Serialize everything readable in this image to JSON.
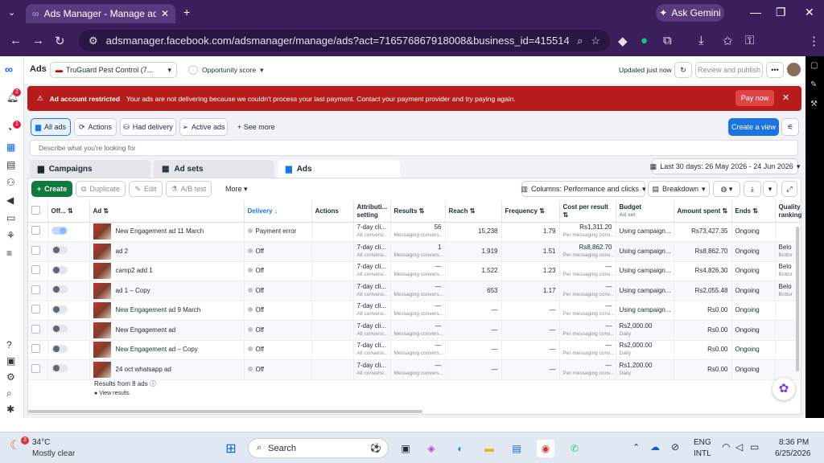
{
  "browser": {
    "tab_title": "Ads Manager - Manage ads - A",
    "url": "adsmanager.facebook.com/adsmanager/manage/ads?act=716576867918008&business_id=4155148604624818...",
    "gemini": "Ask Gemini"
  },
  "topbar": {
    "ads_label": "Ads",
    "account": "TruGuard Pest Control (7...",
    "opportunity": "Opportunity score",
    "updated": "Updated just now",
    "review": "Review and publish",
    "alert_badge": "2",
    "alert_badge2": "1"
  },
  "alert": {
    "title": "Ad account restricted",
    "message": "Your ads are not delivering because we couldn't process your last payment. Contact your payment provider and try paying again.",
    "pay": "Pay now"
  },
  "filters": {
    "all_ads": "All ads",
    "actions": "Actions",
    "had_delivery": "Had delivery",
    "active_ads": "Active ads",
    "see_more": "See more",
    "create_view": "Create a view"
  },
  "search": {
    "placeholder": "Describe what you're looking for"
  },
  "levels": {
    "campaigns": "Campaigns",
    "ad_sets": "Ad sets",
    "ads": "Ads"
  },
  "date_range": "Last 30 days: 26 May 2026 - 24 Jun 2026",
  "toolbar": {
    "create": "Create",
    "duplicate": "Duplicate",
    "edit": "Edit",
    "ab_test": "A/B test",
    "more": "More",
    "columns": "Columns: Performance and clicks",
    "breakdown": "Breakdown"
  },
  "columns": {
    "off_on": "Off...",
    "ad": "Ad",
    "delivery": "Delivery",
    "actions": "Actions",
    "attribution": "Attributi... setting",
    "results": "Results",
    "reach": "Reach",
    "frequency": "Frequency",
    "cost": "Cost per result",
    "budget": "Budget",
    "budget_sub": "Ad set",
    "amount": "Amount spent",
    "ends": "Ends",
    "quality": "Quality ranking"
  },
  "rows": [
    {
      "name": "New Engagement ad 11 March",
      "delivery": "Payment error",
      "attr": "7-day cli...",
      "attr_sub": "All conversi...",
      "results": "56",
      "results_sub": "Messaging convers...",
      "reach": "15,238",
      "freq": "1.79",
      "cost": "Rs1,311.20",
      "cost_sub": "Per messaging conv...",
      "budget": "Using campaign...",
      "budget_sub": "",
      "amount": "Rs73,427.35",
      "ends": "Ongoing",
      "quality": "",
      "quality_sub": "",
      "on": true
    },
    {
      "name": "ad 2",
      "delivery": "Off",
      "attr": "7-day cli...",
      "attr_sub": "All conversi...",
      "results": "1",
      "results_sub": "Messaging convers...",
      "reach": "1,919",
      "freq": "1.51",
      "cost": "Rs8,862.70",
      "cost_sub": "Per messaging conv...",
      "budget": "Using campaign...",
      "budget_sub": "",
      "amount": "Rs8,862.70",
      "ends": "Ongoing",
      "quality": "Belo",
      "quality_sub": "Bottor",
      "on": false
    },
    {
      "name": "camp2 add 1",
      "delivery": "Off",
      "attr": "7-day cli...",
      "attr_sub": "All conversi...",
      "results": "—",
      "results_sub": "Messaging convers...",
      "reach": "1,522",
      "freq": "1.23",
      "cost": "—",
      "cost_sub": "Per messaging conv...",
      "budget": "Using campaign...",
      "budget_sub": "",
      "amount": "Rs4,826.30",
      "ends": "Ongoing",
      "quality": "Belo",
      "quality_sub": "Bottor",
      "on": false
    },
    {
      "name": "ad 1 – Copy",
      "delivery": "Off",
      "attr": "7-day cli...",
      "attr_sub": "All conversi...",
      "results": "—",
      "results_sub": "Messaging convers...",
      "reach": "653",
      "freq": "1.17",
      "cost": "—",
      "cost_sub": "Per messaging conv...",
      "budget": "Using campaign...",
      "budget_sub": "",
      "amount": "Rs2,055.48",
      "ends": "Ongoing",
      "quality": "Belo",
      "quality_sub": "Bottor",
      "on": false
    },
    {
      "name": "New Engagement ad 9 March",
      "delivery": "Off",
      "attr": "7-day cli...",
      "attr_sub": "All conversi...",
      "results": "—",
      "results_sub": "Messaging convers...",
      "reach": "—",
      "freq": "—",
      "cost": "—",
      "cost_sub": "Per messaging conv...",
      "budget": "Using campaign...",
      "budget_sub": "",
      "amount": "Rs0.00",
      "ends": "Ongoing",
      "quality": "",
      "quality_sub": "",
      "on": false
    },
    {
      "name": "New Engagement ad",
      "delivery": "Off",
      "attr": "7-day cli...",
      "attr_sub": "All conversi...",
      "results": "—",
      "results_sub": "Messaging convers...",
      "reach": "—",
      "freq": "—",
      "cost": "—",
      "cost_sub": "Per messaging conv...",
      "budget": "Rs2,000.00",
      "budget_sub": "Daily",
      "amount": "Rs0.00",
      "ends": "Ongoing",
      "quality": "",
      "quality_sub": "",
      "on": false
    },
    {
      "name": "New Engagement ad – Copy",
      "delivery": "Off",
      "attr": "7-day cli...",
      "attr_sub": "All conversi...",
      "results": "—",
      "results_sub": "Messaging convers...",
      "reach": "—",
      "freq": "—",
      "cost": "—",
      "cost_sub": "Per messaging conv...",
      "budget": "Rs2,000.00",
      "budget_sub": "Daily",
      "amount": "Rs0.00",
      "ends": "Ongoing",
      "quality": "",
      "quality_sub": "",
      "on": false
    },
    {
      "name": "24 oct whatsapp ad",
      "delivery": "Off",
      "attr": "7-day cli...",
      "attr_sub": "All conversi...",
      "results": "—",
      "results_sub": "Messaging convers...",
      "reach": "—",
      "freq": "—",
      "cost": "—",
      "cost_sub": "Per messaging conv...",
      "budget": "Rs1,200.00",
      "budget_sub": "Daily",
      "amount": "Rs0.00",
      "ends": "Ongoing",
      "quality": "",
      "quality_sub": "",
      "on": false
    }
  ],
  "summary": {
    "results": "Results from 8 ads",
    "view": "View results"
  },
  "taskbar": {
    "temp": "34°C",
    "weather": "Mostly clear",
    "badge": "3",
    "search": "Search",
    "lang1": "ENG",
    "lang2": "INTL",
    "time": "8:36 PM",
    "date": "6/25/2026"
  }
}
